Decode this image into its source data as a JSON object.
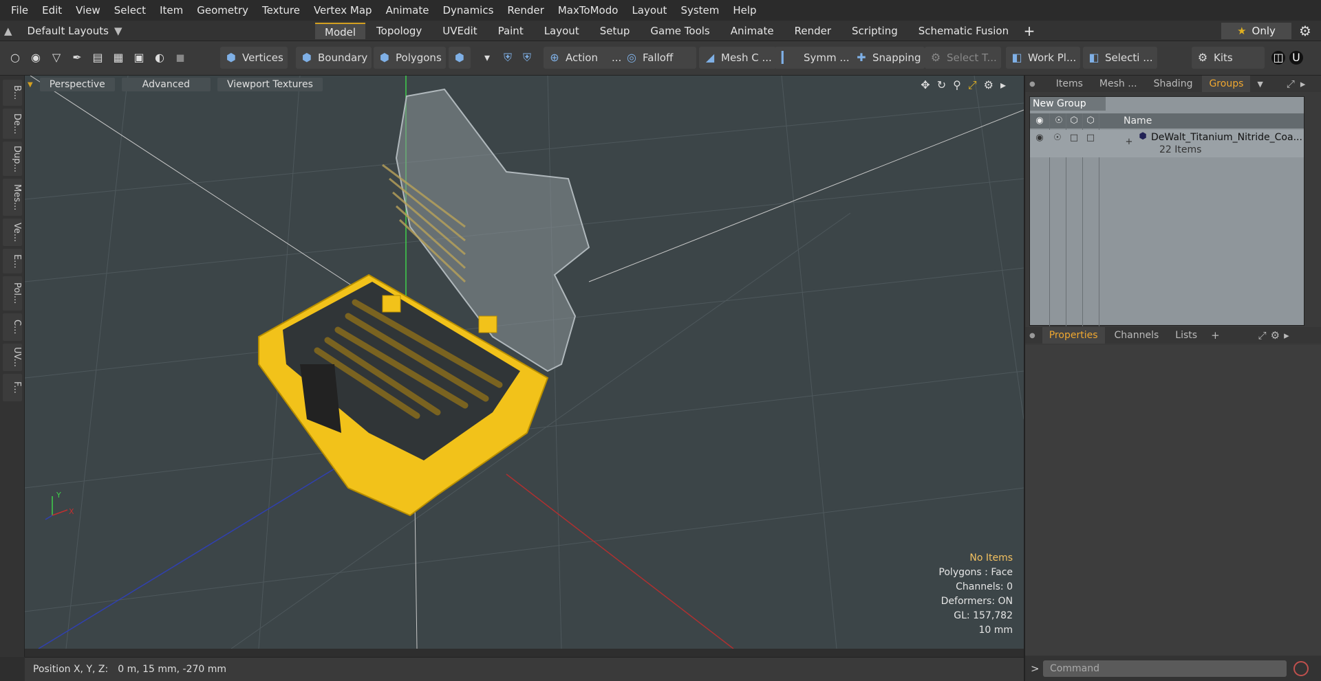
{
  "menubar": [
    "File",
    "Edit",
    "View",
    "Select",
    "Item",
    "Geometry",
    "Texture",
    "Vertex Map",
    "Animate",
    "Dynamics",
    "Render",
    "MaxToModo",
    "Layout",
    "System",
    "Help"
  ],
  "layout_selector": "Default Layouts",
  "tabs": [
    "Model",
    "Topology",
    "UVEdit",
    "Paint",
    "Layout",
    "Setup",
    "Game Tools",
    "Animate",
    "Render",
    "Scripting",
    "Schematic Fusion"
  ],
  "active_tab": "Model",
  "only_label": "Only",
  "toolbar": {
    "vertices": "Vertices",
    "boundary": "Boundary",
    "polygons": "Polygons",
    "action": "Action",
    "falloff": "Falloff",
    "mesh_c": "Mesh C ...",
    "symm": "Symm ...",
    "snapping": "Snapping",
    "select_t": "Select T...",
    "work_pl": "Work Pl...",
    "selecti": "Selecti ...",
    "kits": "Kits"
  },
  "left_tabs": [
    "B...",
    "De...",
    "Dup...",
    "Mes...",
    "Ve...",
    "E...",
    "Pol...",
    "C...",
    "UV...",
    "F..."
  ],
  "viewport": {
    "perspective": "Perspective",
    "advanced": "Advanced",
    "viewport_textures": "Viewport Textures",
    "info": {
      "no_items": "No Items",
      "polygons": "Polygons : Face",
      "channels": "Channels: 0",
      "deformers": "Deformers: ON",
      "gl": "GL: 157,782",
      "scale": "10 mm"
    }
  },
  "status": {
    "label": "Position X, Y, Z:",
    "value": "0 m, 15 mm, -270 mm"
  },
  "right_panel": {
    "tabs": [
      "Items",
      "Mesh ...",
      "Shading",
      "Groups"
    ],
    "active_tab": "Groups",
    "new_group": "New Group",
    "name_header": "Name",
    "group_name": "DeWalt_Titanium_Nitride_Coa...",
    "group_count": "22 Items",
    "bottom_tabs": [
      "Properties",
      "Channels",
      "Lists"
    ],
    "bottom_active": "Properties",
    "command_placeholder": "Command"
  },
  "colors": {
    "accent": "#f0a830",
    "case_yellow": "#f2c21a",
    "viewport_bg": "#3c4548"
  }
}
